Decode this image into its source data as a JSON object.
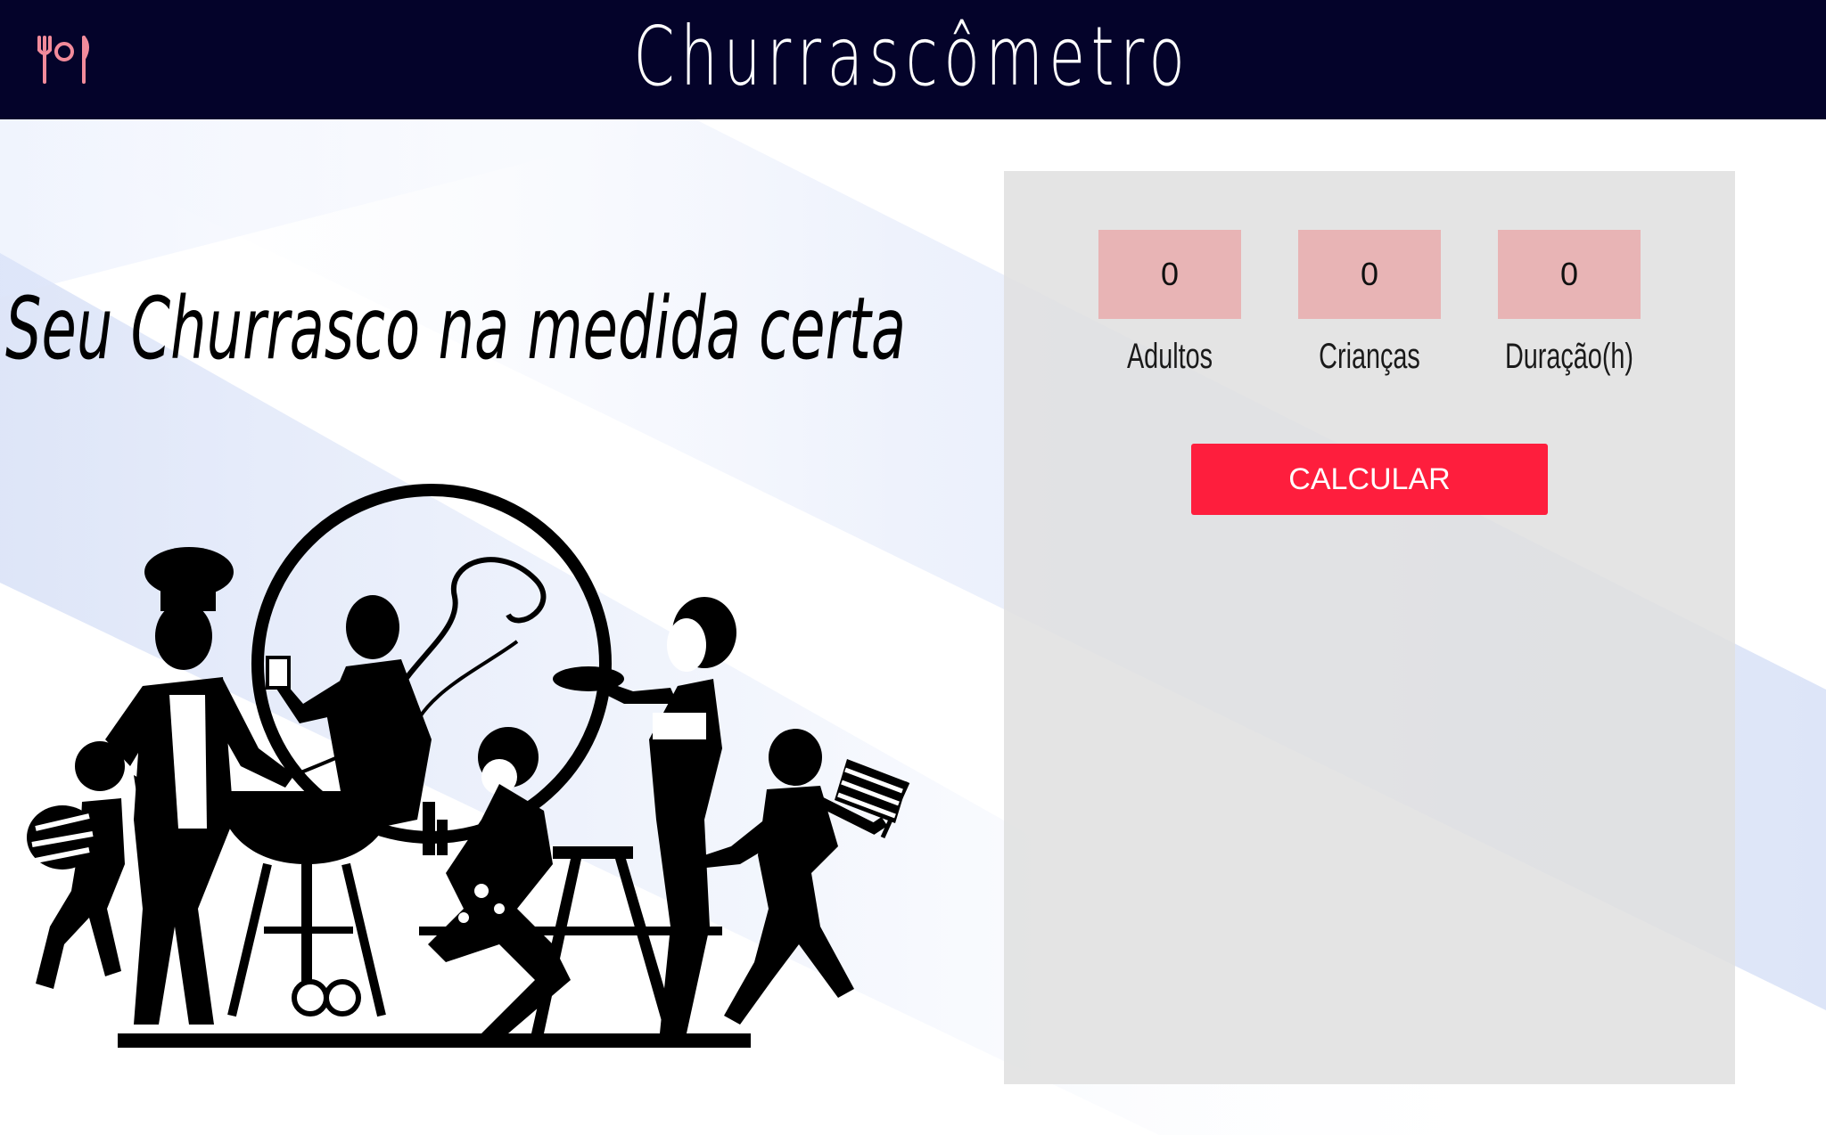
{
  "header": {
    "title": "Churrascômetro",
    "logo_icon": "fork-plate-knife-icon",
    "background_color": "#04032a",
    "icon_color": "#f28b9b"
  },
  "hero": {
    "tagline": "Seu Churrasco na medida certa",
    "illustration": "family-barbecue-silhouette"
  },
  "calculator": {
    "fields": [
      {
        "value": "0",
        "label": "Adultos"
      },
      {
        "value": "0",
        "label": "Crianças"
      },
      {
        "value": "0",
        "label": "Duração(h)"
      }
    ],
    "button_label": "CALCULAR",
    "input_color": "#e8b4b5",
    "button_color": "#fe1e3d",
    "panel_color": "#e0e0e0"
  }
}
